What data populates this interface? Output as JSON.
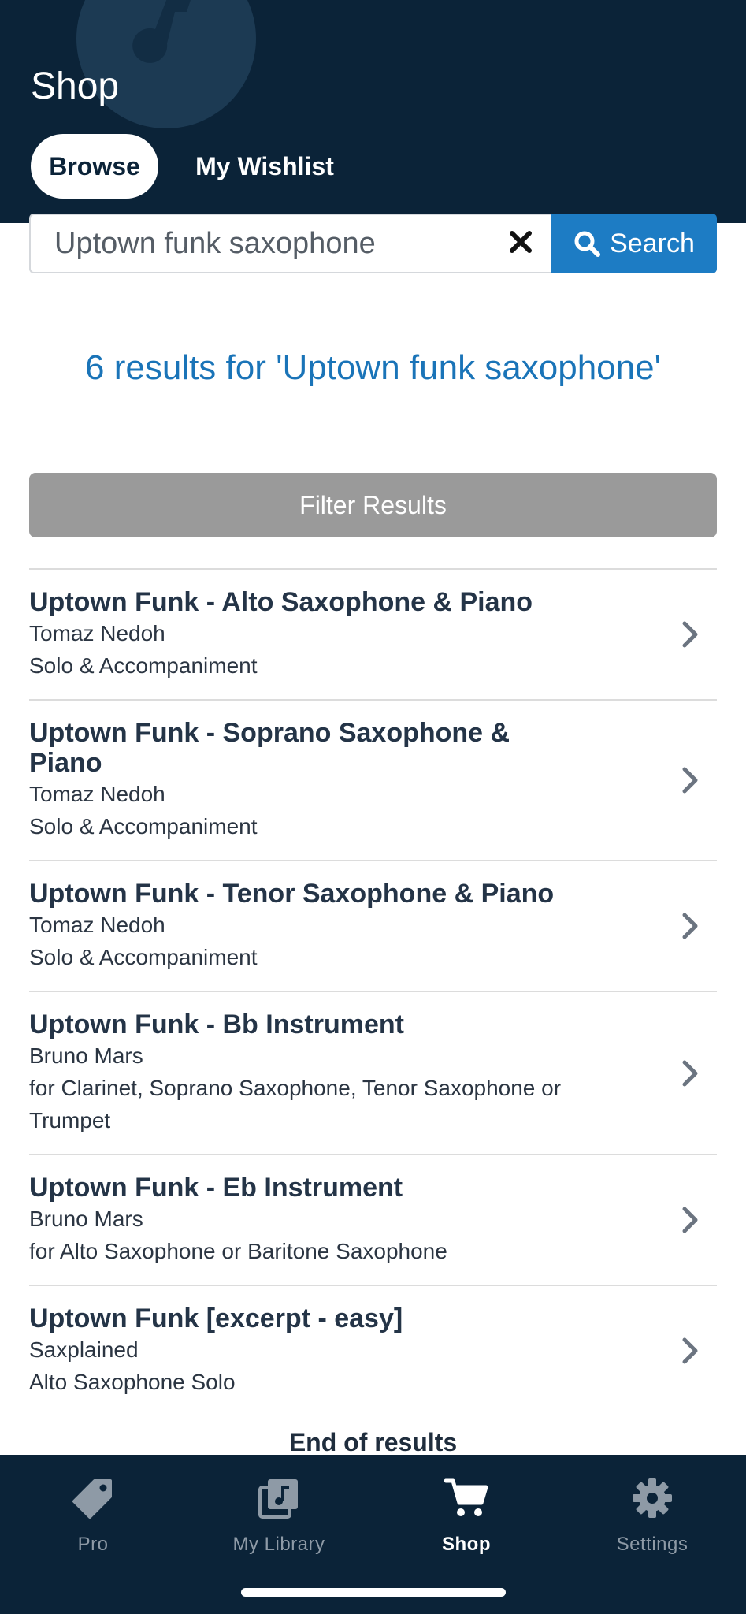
{
  "header": {
    "title": "Shop",
    "tabs": [
      {
        "label": "Browse",
        "active": true
      },
      {
        "label": "My Wishlist",
        "active": false
      }
    ]
  },
  "search": {
    "value": "Uptown funk saxophone",
    "button_label": "Search"
  },
  "results_heading": "6 results for 'Uptown funk saxophone'",
  "filter_label": "Filter Results",
  "results": [
    {
      "title": "Uptown Funk - Alto Saxophone & Piano",
      "line1": "Tomaz Nedoh",
      "line2": "Solo & Accompaniment"
    },
    {
      "title": "Uptown Funk - Soprano Saxophone & Piano",
      "line1": "Tomaz Nedoh",
      "line2": "Solo & Accompaniment"
    },
    {
      "title": "Uptown Funk - Tenor Saxophone & Piano",
      "line1": "Tomaz Nedoh",
      "line2": "Solo & Accompaniment"
    },
    {
      "title": "Uptown Funk - Bb Instrument",
      "line1": "Bruno Mars",
      "line2": "for Clarinet, Soprano Saxophone, Tenor Saxophone or Trumpet"
    },
    {
      "title": "Uptown Funk - Eb Instrument",
      "line1": "Bruno Mars",
      "line2": "for Alto Saxophone or Baritone Saxophone"
    },
    {
      "title": "Uptown Funk [excerpt - easy]",
      "line1": "Saxplained",
      "line2": "Alto Saxophone Solo"
    }
  ],
  "end_text": "End of results",
  "nav": [
    {
      "label": "Pro",
      "icon": "tag-icon",
      "active": false
    },
    {
      "label": "My Library",
      "icon": "music-library-icon",
      "active": false
    },
    {
      "label": "Shop",
      "icon": "cart-icon",
      "active": true
    },
    {
      "label": "Settings",
      "icon": "gear-icon",
      "active": false
    }
  ],
  "colors": {
    "header_bg": "#0b2338",
    "accent": "#1d7cc4",
    "heading": "#1a74b8",
    "filter_bg": "#9a9a9a"
  }
}
